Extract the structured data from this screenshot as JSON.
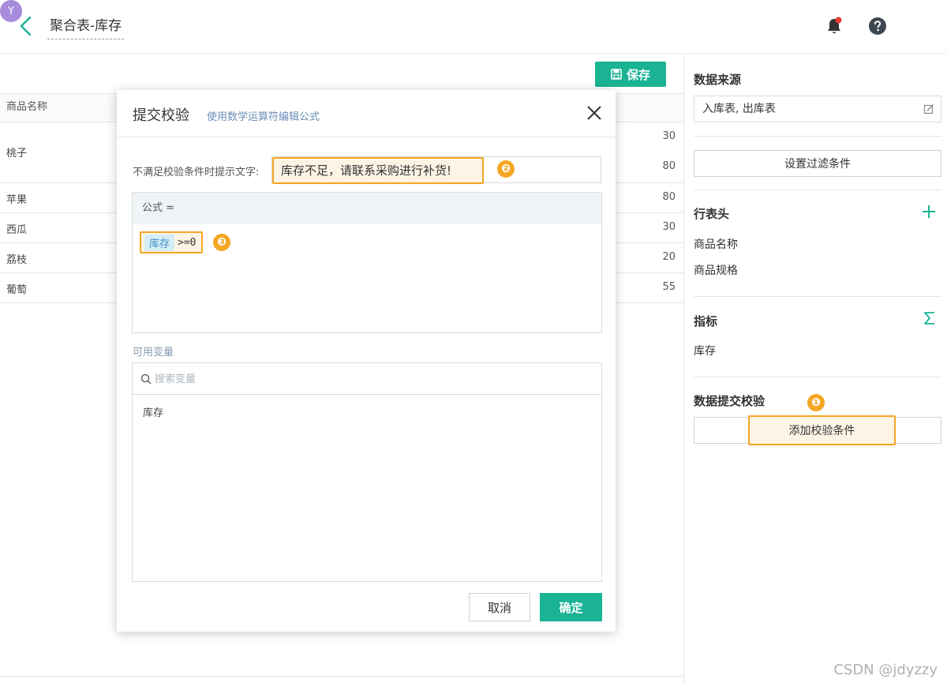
{
  "header": {
    "title": "聚合表-库存",
    "avatar_letter": "Y"
  },
  "toolbar": {
    "save_label": "保存"
  },
  "table": {
    "header_label": "商品名称",
    "rows": [
      {
        "name": "桃子",
        "values": [
          "30",
          "80"
        ]
      },
      {
        "name": "苹果",
        "values": [
          "80"
        ]
      },
      {
        "name": "西瓜",
        "values": [
          "30"
        ]
      },
      {
        "name": "荔枝",
        "values": [
          "20"
        ]
      },
      {
        "name": "葡萄",
        "values": [
          "55"
        ]
      }
    ]
  },
  "panel": {
    "data_source_title": "数据来源",
    "data_source_value": "入库表, 出库表",
    "filter_button": "设置过滤条件",
    "row_header_title": "行表头",
    "row_header_items": [
      "商品名称",
      "商品规格"
    ],
    "metrics_title": "指标",
    "metrics_items": [
      "库存"
    ],
    "validation_title": "数据提交校验",
    "add_validation_button": "添加校验条件"
  },
  "modal": {
    "title": "提交校验",
    "subtitle": "使用数学运算符编辑公式",
    "tip_label": "不满足校验条件时提示文字:",
    "tip_value": "库存不足，请联系采购进行补货!",
    "formula_label": "公式 =",
    "formula_var": "库存",
    "formula_op": ">=0",
    "vars_label": "可用变量",
    "search_placeholder": "搜索变量",
    "vars": [
      "库存"
    ],
    "cancel_label": "取消",
    "ok_label": "确定"
  },
  "annotations": {
    "badge1": "❶",
    "badge2": "❷",
    "badge3": "❸"
  },
  "watermark": "CSDN @jdyzzy",
  "colors": {
    "accent": "#1ab394",
    "highlight": "#f5a623",
    "avatar": "#a78bdc",
    "notify_dot": "#e53935"
  }
}
